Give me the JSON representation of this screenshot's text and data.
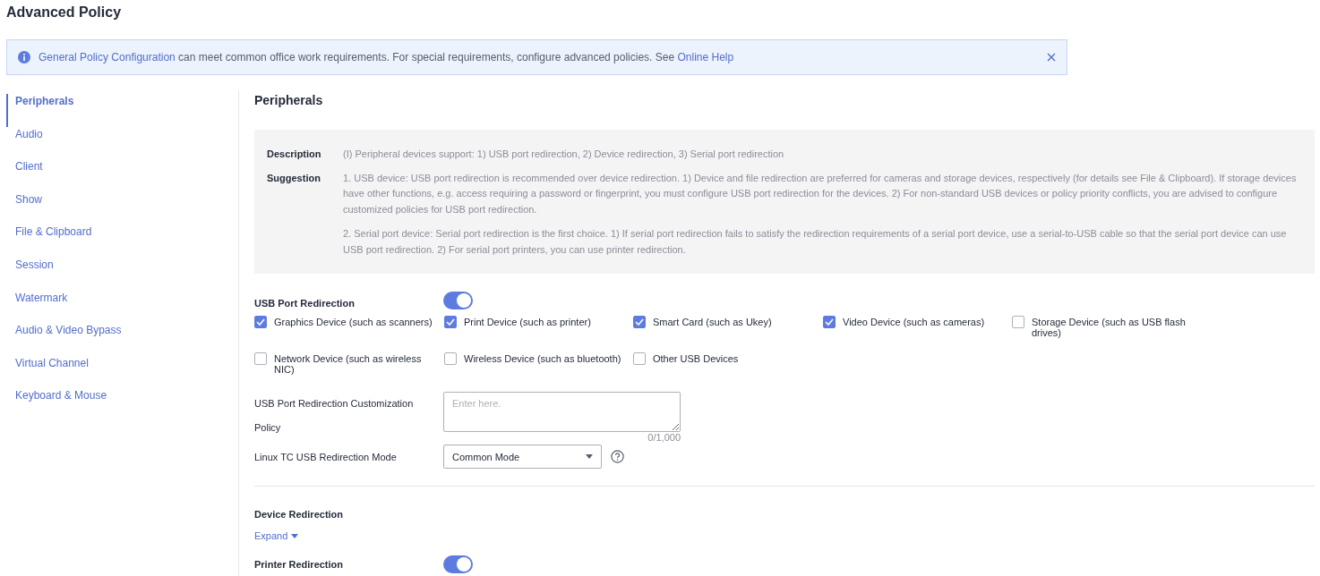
{
  "page_title": "Advanced Policy",
  "notice": {
    "parts": [
      {
        "kind": "link",
        "text": "General Policy Configuration"
      },
      {
        "kind": "plain",
        "text": " can meet common office work requirements. For special requirements, configure advanced policies. See "
      },
      {
        "kind": "link",
        "text": "Online Help"
      }
    ]
  },
  "sidebar": {
    "items": [
      {
        "label": "Peripherals",
        "selected": true
      },
      {
        "label": "Audio",
        "selected": false
      },
      {
        "label": "Client",
        "selected": false
      },
      {
        "label": "Show",
        "selected": false
      },
      {
        "label": "File & Clipboard",
        "selected": false
      },
      {
        "label": "Session",
        "selected": false
      },
      {
        "label": "Watermark",
        "selected": false
      },
      {
        "label": "Audio & Video Bypass",
        "selected": false
      },
      {
        "label": "Virtual Channel",
        "selected": false
      },
      {
        "label": "Keyboard & Mouse",
        "selected": false
      }
    ]
  },
  "section_title": "Peripherals",
  "info": [
    {
      "label": "Description",
      "paragraphs": [
        "(I) Peripheral devices support: 1) USB port redirection, 2) Device redirection, 3) Serial port redirection"
      ]
    },
    {
      "label": "Suggestion",
      "paragraphs": [
        "1. USB device: USB port redirection is recommended over device redirection. 1) Device and file redirection are preferred for cameras and storage devices, respectively (for details see File & Clipboard). If storage devices have other functions, e.g. access requiring a password or fingerprint, you must configure USB port redirection for the devices. 2) For non-standard USB devices or policy priority conflicts, you are advised to configure customized policies for USB port redirection.",
        "2. Serial port device: Serial port redirection is the first choice. 1) If serial port redirection fails to satisfy the redirection requirements of a serial port device, use a serial-to-USB cable so that the serial port device can use USB port redirection. 2) For serial port printers, you can use printer redirection."
      ]
    }
  ],
  "usb_port_redirection": {
    "label": "USB Port Redirection",
    "on": true,
    "devices": [
      {
        "label": "Graphics Device (such as scanners)",
        "checked": true
      },
      {
        "label": "Print Device (such as printer)",
        "checked": true
      },
      {
        "label": "Smart Card (such as Ukey)",
        "checked": true
      },
      {
        "label": "Video Device (such as cameras)",
        "checked": true
      },
      {
        "label": "Storage Device (such as USB flash drives)",
        "checked": false
      },
      {
        "label": "Network Device (such as wireless NIC)",
        "checked": false
      },
      {
        "label": "Wireless Device (such as bluetooth)",
        "checked": false
      },
      {
        "label": "Other USB Devices",
        "checked": false
      }
    ],
    "policy_label": "USB Port Redirection Customization Policy",
    "policy_placeholder": "Enter here.",
    "policy_counter": "0/1,000",
    "mode_label": "Linux TC USB Redirection Mode",
    "mode_value": "Common Mode"
  },
  "device_redirection": {
    "label": "Device Redirection",
    "expand": "Expand"
  },
  "printer_redirection": {
    "label": "Printer Redirection",
    "on": true
  }
}
